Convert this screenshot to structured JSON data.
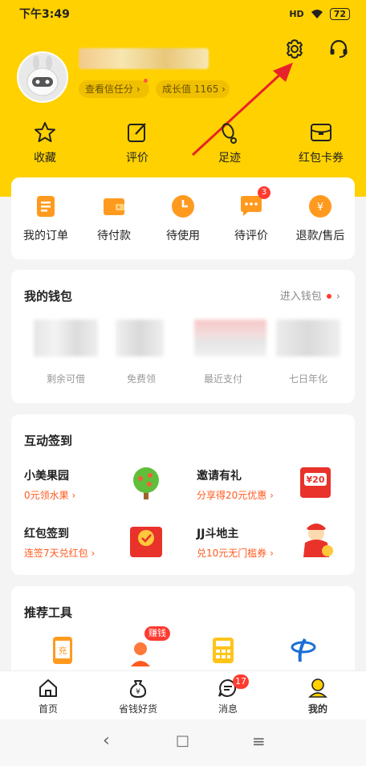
{
  "status_bar": {
    "time": "下午3:49",
    "network": "HD",
    "battery": "72"
  },
  "profile": {
    "credit_label": "查看信任分",
    "growth_label": "成长值 1165"
  },
  "header_actions": {
    "settings_icon": "gear-icon",
    "support_icon": "headset-icon"
  },
  "quick_links": [
    {
      "label": "收藏",
      "icon": "star-icon"
    },
    {
      "label": "评价",
      "icon": "edit-icon"
    },
    {
      "label": "足迹",
      "icon": "footprint-icon"
    },
    {
      "label": "红包卡券",
      "icon": "coupon-icon"
    }
  ],
  "orders": [
    {
      "label": "我的订单",
      "icon": "order-list-icon",
      "badge": ""
    },
    {
      "label": "待付款",
      "icon": "wallet-icon",
      "badge": ""
    },
    {
      "label": "待使用",
      "icon": "clock-icon",
      "badge": ""
    },
    {
      "label": "待评价",
      "icon": "comment-icon",
      "badge": "3"
    },
    {
      "label": "退款/售后",
      "icon": "refund-icon",
      "badge": ""
    }
  ],
  "wallet": {
    "title": "我的钱包",
    "enter_label": "进入钱包",
    "items": [
      "剩余可借",
      "免费领",
      "最近支付",
      "七日年化"
    ]
  },
  "activities": {
    "title": "互动签到",
    "items": [
      {
        "title": "小美果园",
        "sub": "0元领水果 ›",
        "icon": "tree-icon"
      },
      {
        "title": "邀请有礼",
        "sub": "分享得20元优惠 ›",
        "icon": "red-envelope-icon",
        "amount": "¥20"
      },
      {
        "title": "红包签到",
        "sub": "连签7天兑红包 ›",
        "icon": "checkin-envelope-icon"
      },
      {
        "title": "JJ斗地主",
        "sub": "兑10元无门槛券 ›",
        "icon": "god-of-wealth-icon"
      }
    ]
  },
  "tools": {
    "title": "推荐工具",
    "items": [
      {
        "icon": "phone-recharge-icon",
        "label": "充"
      },
      {
        "icon": "earn-money-icon",
        "badge": "赚钱"
      },
      {
        "icon": "calculator-icon"
      },
      {
        "icon": "telecom-icon"
      }
    ]
  },
  "tabbar": [
    {
      "label": "首页",
      "icon": "home-icon",
      "active": false
    },
    {
      "label": "省钱好货",
      "icon": "money-bag-icon",
      "active": false
    },
    {
      "label": "消息",
      "icon": "message-icon",
      "badge": "17",
      "active": false
    },
    {
      "label": "我的",
      "icon": "profile-icon",
      "active": true
    }
  ],
  "navbar": {
    "back": "‹",
    "home": "□",
    "menu": "≡"
  },
  "colors": {
    "brand_yellow": "#ffd100",
    "accent_orange": "#ff5a1f",
    "badge_red": "#ff3b30",
    "arrow_red": "#e8222a"
  }
}
